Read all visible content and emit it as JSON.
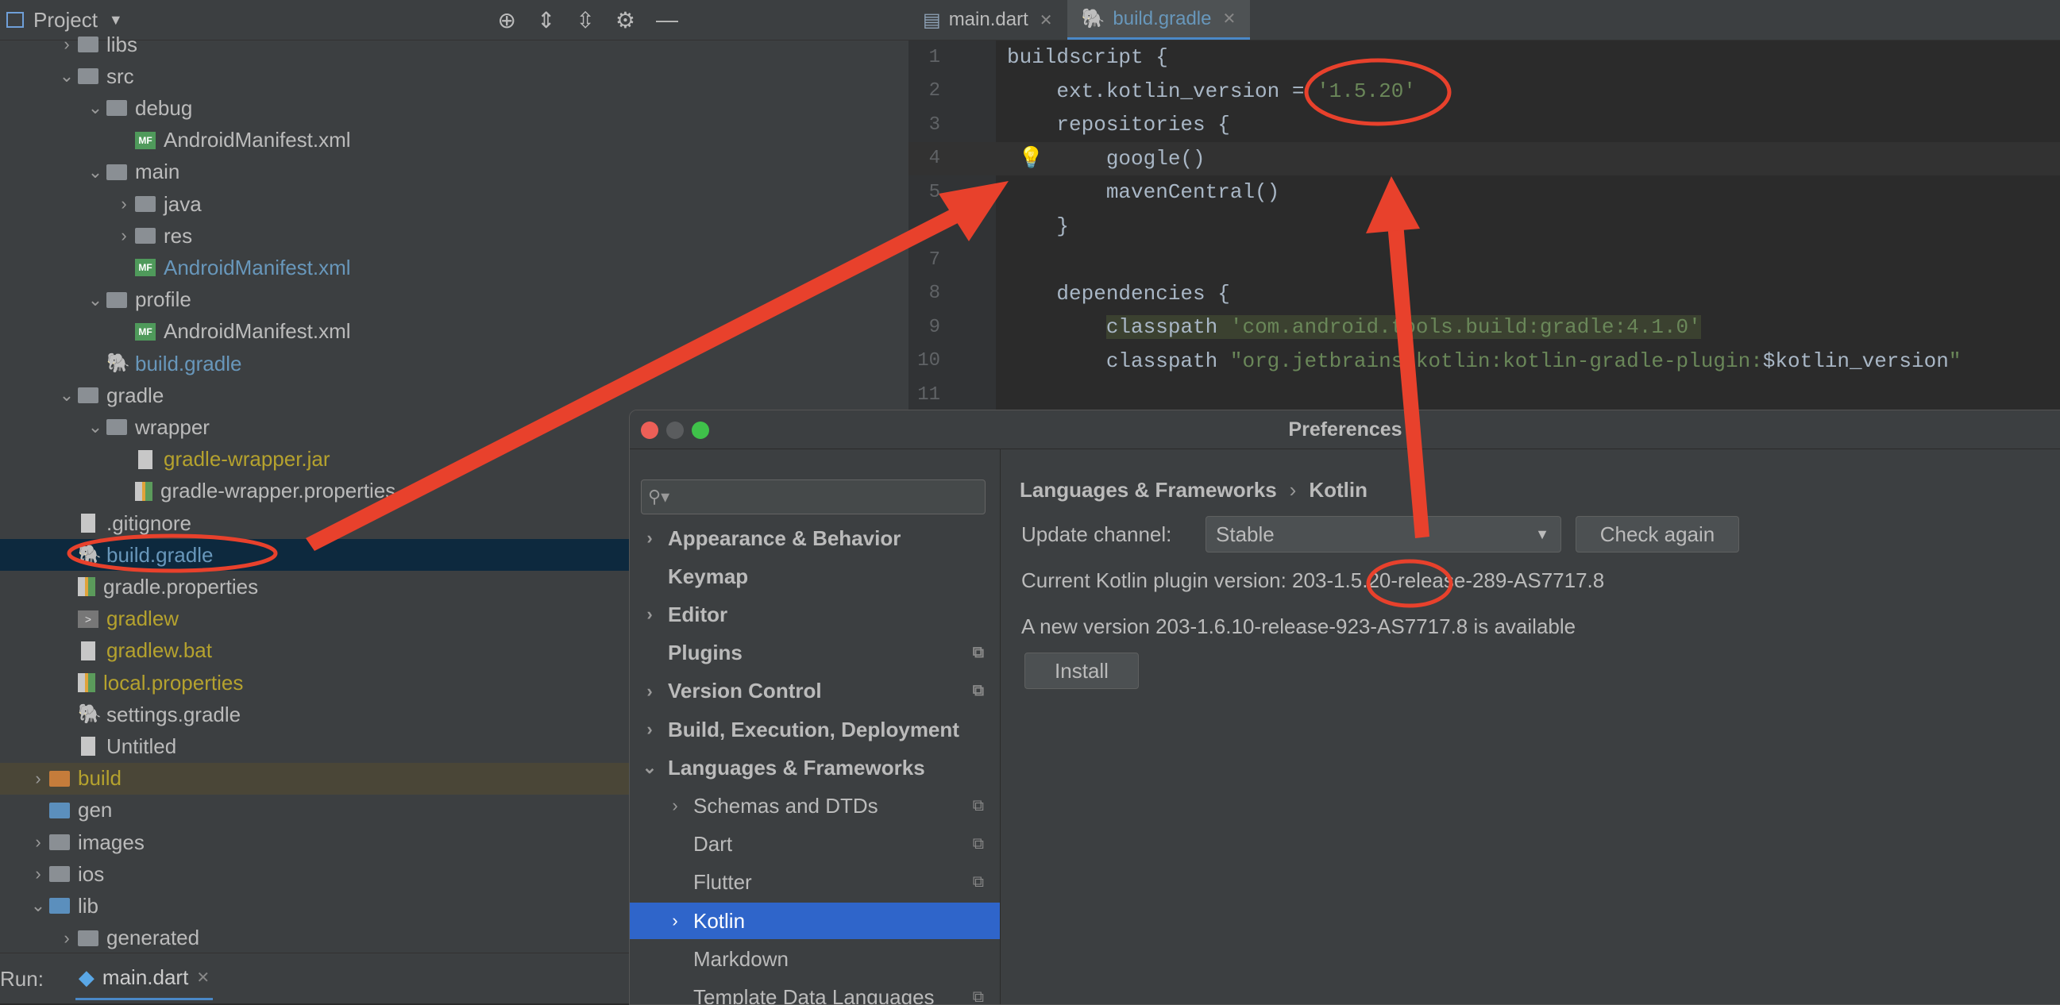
{
  "project_panel": {
    "title": "Project",
    "tree": [
      {
        "label": "libs",
        "indent": 1,
        "arrow": "right",
        "icon": "folder-icon",
        "color": "default"
      },
      {
        "label": "src",
        "indent": 1,
        "arrow": "down",
        "icon": "folder-icon",
        "color": "default"
      },
      {
        "label": "debug",
        "indent": 2,
        "arrow": "down",
        "icon": "folder-icon",
        "color": "default"
      },
      {
        "label": "AndroidManifest.xml",
        "indent": 3,
        "arrow": "",
        "icon": "manifest-icon",
        "color": "default"
      },
      {
        "label": "main",
        "indent": 2,
        "arrow": "down",
        "icon": "folder-icon",
        "color": "default"
      },
      {
        "label": "java",
        "indent": 3,
        "arrow": "right",
        "icon": "folder-icon",
        "color": "default"
      },
      {
        "label": "res",
        "indent": 3,
        "arrow": "right",
        "icon": "folder-icon",
        "color": "default"
      },
      {
        "label": "AndroidManifest.xml",
        "indent": 3,
        "arrow": "",
        "icon": "manifest-icon",
        "color": "blue"
      },
      {
        "label": "profile",
        "indent": 2,
        "arrow": "down",
        "icon": "folder-icon",
        "color": "default"
      },
      {
        "label": "AndroidManifest.xml",
        "indent": 3,
        "arrow": "",
        "icon": "manifest-icon",
        "color": "default"
      },
      {
        "label": "build.gradle",
        "indent": 2,
        "arrow": "",
        "icon": "gradle-icon",
        "color": "blue"
      },
      {
        "label": "gradle",
        "indent": 1,
        "arrow": "down",
        "icon": "folder-icon",
        "color": "default"
      },
      {
        "label": "wrapper",
        "indent": 2,
        "arrow": "down",
        "icon": "folder-icon",
        "color": "default"
      },
      {
        "label": "gradle-wrapper.jar",
        "indent": 3,
        "arrow": "",
        "icon": "jar-icon",
        "color": "yellow"
      },
      {
        "label": "gradle-wrapper.properties",
        "indent": 3,
        "arrow": "",
        "icon": "properties-icon",
        "color": "default"
      },
      {
        "label": ".gitignore",
        "indent": 1,
        "arrow": "",
        "icon": "file-icon",
        "color": "default"
      },
      {
        "label": "build.gradle",
        "indent": 1,
        "arrow": "",
        "icon": "gradle-icon",
        "color": "blue",
        "selected": true
      },
      {
        "label": "gradle.properties",
        "indent": 1,
        "arrow": "",
        "icon": "properties-icon",
        "color": "default"
      },
      {
        "label": "gradlew",
        "indent": 1,
        "arrow": "",
        "icon": "terminal-icon",
        "color": "yellow"
      },
      {
        "label": "gradlew.bat",
        "indent": 1,
        "arrow": "",
        "icon": "file-icon",
        "color": "yellow"
      },
      {
        "label": "local.properties",
        "indent": 1,
        "arrow": "",
        "icon": "properties-icon",
        "color": "yellow"
      },
      {
        "label": "settings.gradle",
        "indent": 1,
        "arrow": "",
        "icon": "gradle-icon",
        "color": "default"
      },
      {
        "label": "Untitled",
        "indent": 1,
        "arrow": "",
        "icon": "file-icon",
        "color": "default"
      },
      {
        "label": "build",
        "indent": 0,
        "arrow": "right",
        "icon": "folder-orange-icon",
        "color": "yellow",
        "highlight": true
      },
      {
        "label": "gen",
        "indent": 0,
        "arrow": "",
        "icon": "folder-blue-icon",
        "color": "default"
      },
      {
        "label": "images",
        "indent": 0,
        "arrow": "right",
        "icon": "folder-icon",
        "color": "default"
      },
      {
        "label": "ios",
        "indent": 0,
        "arrow": "right",
        "icon": "folder-icon",
        "color": "default"
      },
      {
        "label": "lib",
        "indent": 0,
        "arrow": "down",
        "icon": "folder-blue-icon",
        "color": "default"
      },
      {
        "label": "generated",
        "indent": 1,
        "arrow": "right",
        "icon": "folder-icon",
        "color": "default"
      }
    ]
  },
  "run_bar": {
    "label": "Run:",
    "tab": "main.dart"
  },
  "editor": {
    "tabs": [
      {
        "label": "main.dart",
        "active": false
      },
      {
        "label": "build.gradle",
        "active": true
      }
    ],
    "lines": [
      {
        "n": "1",
        "segs": [
          {
            "t": "buildscript {",
            "c": ""
          }
        ]
      },
      {
        "n": "2",
        "segs": [
          {
            "t": "    ext.kotlin_version = ",
            "c": ""
          },
          {
            "t": "'1.5.20'",
            "c": "s"
          }
        ]
      },
      {
        "n": "3",
        "segs": [
          {
            "t": "    repositories {",
            "c": ""
          }
        ]
      },
      {
        "n": "4",
        "segs": [
          {
            "t": "        google()",
            "c": ""
          }
        ],
        "current": true
      },
      {
        "n": "5",
        "segs": [
          {
            "t": "        mavenCentral()",
            "c": ""
          }
        ]
      },
      {
        "n": "",
        "segs": [
          {
            "t": "    }",
            "c": ""
          }
        ]
      },
      {
        "n": "7",
        "segs": [
          {
            "t": "",
            "c": ""
          }
        ]
      },
      {
        "n": "8",
        "segs": [
          {
            "t": "    dependencies {",
            "c": ""
          }
        ]
      },
      {
        "n": "9",
        "segs": [
          {
            "t": "        ",
            "c": ""
          },
          {
            "t": "classpath ",
            "c": "hl"
          },
          {
            "t": "'com.android.tools.build:gradle:4.1.0'",
            "c": "s hl"
          }
        ]
      },
      {
        "n": "10",
        "segs": [
          {
            "t": "        classpath ",
            "c": ""
          },
          {
            "t": "\"org.jetbrains.kotlin:kotlin-gradle-plugin:",
            "c": "s"
          },
          {
            "t": "$kotlin_version",
            "c": ""
          },
          {
            "t": "\"",
            "c": "s"
          }
        ]
      },
      {
        "n": "11",
        "segs": [
          {
            "t": "",
            "c": ""
          }
        ]
      }
    ]
  },
  "preferences": {
    "title": "Preferences",
    "search_placeholder": "",
    "sidebar": [
      {
        "label": "Appearance & Behavior",
        "arrow": "right",
        "bold": true,
        "indent": 0,
        "copy": false
      },
      {
        "label": "Keymap",
        "arrow": "",
        "bold": true,
        "indent": 0,
        "copy": false
      },
      {
        "label": "Editor",
        "arrow": "right",
        "bold": true,
        "indent": 0,
        "copy": false
      },
      {
        "label": "Plugins",
        "arrow": "",
        "bold": true,
        "indent": 0,
        "copy": true
      },
      {
        "label": "Version Control",
        "arrow": "right",
        "bold": true,
        "indent": 0,
        "copy": true
      },
      {
        "label": "Build, Execution, Deployment",
        "arrow": "right",
        "bold": true,
        "indent": 0,
        "copy": false
      },
      {
        "label": "Languages & Frameworks",
        "arrow": "down",
        "bold": true,
        "indent": 0,
        "copy": false
      },
      {
        "label": "Schemas and DTDs",
        "arrow": "right",
        "bold": false,
        "indent": 1,
        "copy": true
      },
      {
        "label": "Dart",
        "arrow": "",
        "bold": false,
        "indent": 1,
        "copy": true
      },
      {
        "label": "Flutter",
        "arrow": "",
        "bold": false,
        "indent": 1,
        "copy": true
      },
      {
        "label": "Kotlin",
        "arrow": "right",
        "bold": false,
        "indent": 1,
        "copy": false,
        "selected": true
      },
      {
        "label": "Markdown",
        "arrow": "",
        "bold": false,
        "indent": 1,
        "copy": false
      },
      {
        "label": "Template Data Languages",
        "arrow": "",
        "bold": false,
        "indent": 1,
        "copy": true
      }
    ],
    "breadcrumb": [
      "Languages & Frameworks",
      "Kotlin"
    ],
    "breadcrumb_sep": "›",
    "update_channel_label": "Update channel:",
    "update_channel_value": "Stable",
    "check_again": "Check again",
    "current_version_text": "Current Kotlin plugin version: 203-1.5.20-release-289-AS7717.8",
    "new_version_text": "A new version 203-1.6.10-release-923-AS7717.8 is available",
    "install": "Install"
  },
  "colors": {
    "annotation": "#e8412c",
    "selection": "#2f65ca",
    "tree_selection": "#0d293e"
  }
}
